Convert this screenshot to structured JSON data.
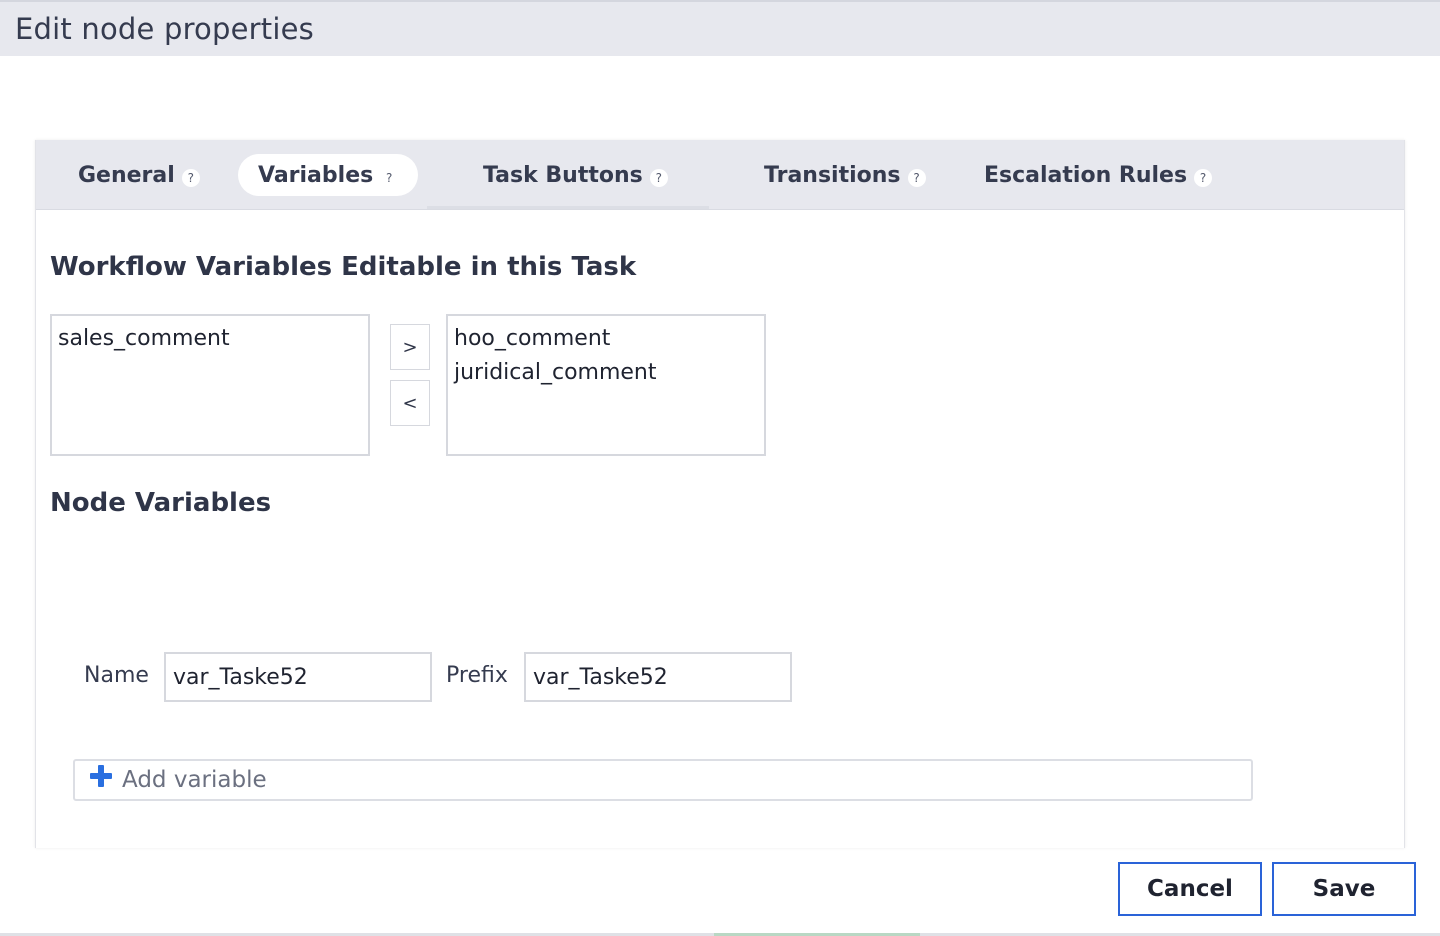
{
  "dialog": {
    "title": "Edit node properties"
  },
  "tabs": [
    {
      "label": "General",
      "help": "?"
    },
    {
      "label": "Variables",
      "help": "?"
    },
    {
      "label": "Task Buttons",
      "help": "?"
    },
    {
      "label": "Transitions",
      "help": "?"
    },
    {
      "label": "Escalation Rules",
      "help": "?"
    }
  ],
  "workflow_variables": {
    "title": "Workflow Variables Editable in this Task",
    "available": [
      "sales_comment"
    ],
    "selected": [
      "hoo_comment",
      "juridical_comment"
    ],
    "move_right_label": ">",
    "move_left_label": "<"
  },
  "node_variables": {
    "title": "Node Variables",
    "name_label": "Name",
    "name_value": "var_Taske52",
    "prefix_label": "Prefix",
    "prefix_value": "var_Taske52",
    "add_label": "Add variable"
  },
  "footer": {
    "cancel_label": "Cancel",
    "save_label": "Save"
  },
  "colors": {
    "accent": "#2a63d8",
    "plus": "#2a6fe0",
    "header_bg": "#e7e8ee"
  }
}
